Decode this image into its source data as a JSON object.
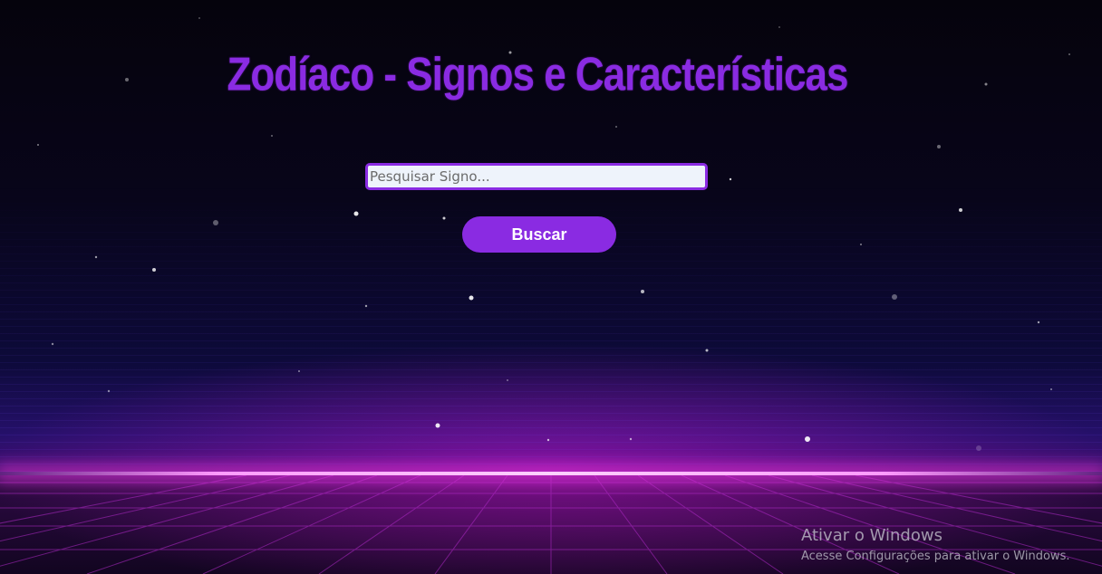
{
  "page": {
    "title": "Zodíaco - Signos e Características"
  },
  "search": {
    "placeholder": "Pesquisar Signo...",
    "value": "",
    "button_label": "Buscar"
  },
  "windows_watermark": {
    "title": "Ativar o Windows",
    "subtitle": "Acesse Configurações para ativar o Windows."
  },
  "colors": {
    "accent": "#8a2be2",
    "button_text": "#ffffff",
    "input_background": "#eef3fb",
    "horizon_glow": "#ff3ce6"
  }
}
